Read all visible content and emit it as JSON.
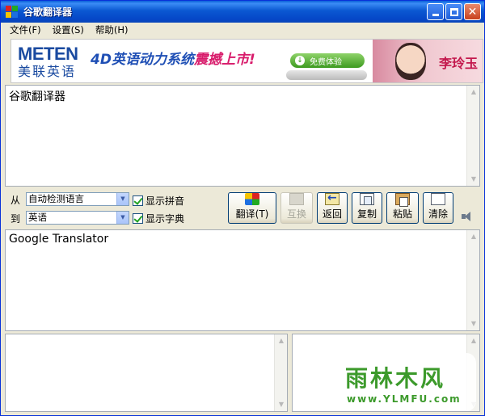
{
  "window": {
    "title": "谷歌翻译器"
  },
  "menu": [
    {
      "label": "文件(F)"
    },
    {
      "label": "设置(S)"
    },
    {
      "label": "帮助(H)"
    }
  ],
  "banner": {
    "logo": "METEN",
    "logo_cn": "美联英语",
    "slogan_prefix": "4D英语动力系统",
    "slogan_highlight": "震撼上市!",
    "trial_button": "免费体验",
    "celebrity_name": "李玲玉"
  },
  "source_text": {
    "value": "谷歌翻译器"
  },
  "from": {
    "label": "从",
    "value": "自动检测语言"
  },
  "to": {
    "label": "到",
    "value": "英语"
  },
  "options": {
    "show_pinyin": {
      "label": "显示拼音",
      "checked": true
    },
    "show_dictionary": {
      "label": "显示字典",
      "checked": true
    }
  },
  "toolbar": {
    "translate": "翻译(T)",
    "swap": "互换",
    "back": "返回",
    "copy": "复制",
    "paste": "粘贴",
    "clear": "清除"
  },
  "result_text": {
    "value": "Google Translator"
  },
  "watermark": {
    "main": "雨林木风",
    "url": "www.YLMFU.com"
  },
  "colors": {
    "titlebar": "#0b58d2",
    "face": "#ece9d8",
    "watermark": "#3c9a2b"
  }
}
